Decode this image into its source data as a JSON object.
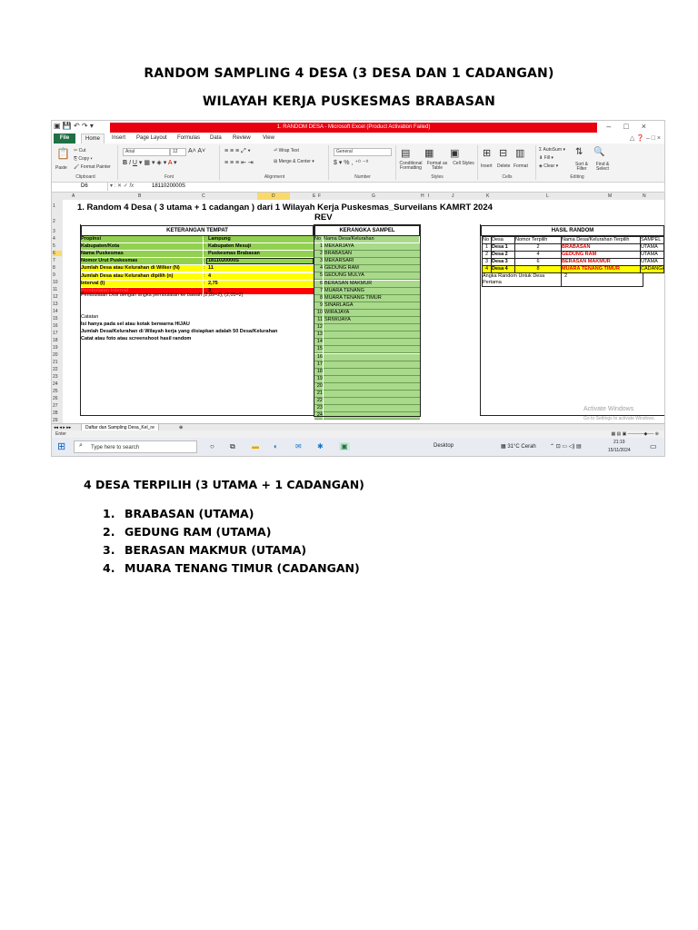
{
  "doc": {
    "title1": "RANDOM SAMPLING 4 DESA (3 DESA DAN 1 CADANGAN)",
    "title2": "WILAYAH KERJA PUSKESMAS BRABASAN",
    "subheading": "4 DESA TERPILIH (3 UTAMA + 1 CADANGAN)",
    "selected": [
      {
        "num": "1.",
        "text": "BRABASAN (UTAMA)"
      },
      {
        "num": "2.",
        "text": "GEDUNG RAM (UTAMA)"
      },
      {
        "num": "3.",
        "text": "BERASAN MAKMUR (UTAMA)"
      },
      {
        "num": "4.",
        "text": "MUARA TENANG TIMUR (CADANGAN)"
      }
    ]
  },
  "excel": {
    "window_title": "1. RANDOM DESA - Microsoft Excel (Product Activation Failed)",
    "menu": {
      "file": "File",
      "tabs": [
        "Home",
        "Insert",
        "Page Layout",
        "Formulas",
        "Data",
        "Review",
        "View"
      ]
    },
    "ribbon": {
      "cut": "Cut",
      "copy": "Copy",
      "paste": "Paste",
      "format_painter": "Format Painter",
      "clipboard": "Clipboard",
      "font_name": "Arial",
      "font_size": "12",
      "font_group": "Font",
      "wrap_text": "Wrap Text",
      "merge_center": "Merge & Center",
      "alignment": "Alignment",
      "number_format": "General",
      "number": "Number",
      "conditional": "Conditional Formatting",
      "format_table": "Format as Table",
      "cell_styles": "Cell Styles",
      "styles": "Styles",
      "insert": "Insert",
      "delete": "Delete",
      "format": "Format",
      "cells": "Cells",
      "autosum": "AutoSum",
      "fill": "Fill",
      "clear": "Clear",
      "sort_filter": "Sort & Filter",
      "find_select": "Find & Select",
      "editing": "Editing"
    },
    "name_box": "D6",
    "formula_value": "1811020000S",
    "columns": [
      "A",
      "B",
      "C",
      "D",
      "E",
      "F",
      "G",
      "H",
      "I",
      "J",
      "K",
      "L",
      "M",
      "N"
    ],
    "sheet_title_1": "1. Random 4 Desa ( 3 utama + 1 cadangan ) dari 1 Wilayah Kerja Puskesmas_Surveilans KAMRT 2024",
    "sheet_title_2": "REV",
    "keterangan_header": "KETERANGAN  TEMPAT",
    "keterangan": [
      {
        "label": "Propinsi",
        "sep": ":",
        "value": "Lampung"
      },
      {
        "label": "Kabupaten/Kota",
        "sep": ":",
        "value": "Kabupaten Mesuji"
      },
      {
        "label": "Nama Puskesmas",
        "sep": ":",
        "value": "Puskesmas Brabasan"
      },
      {
        "label": "Nomor Urut Puskesmas",
        "sep": ":",
        "value": "1811020000S"
      },
      {
        "label": "Jumlah Desa atau Kelurahan di Wilker (N)",
        "sep": ":",
        "value": "11"
      },
      {
        "label": "Jumlah Desa atau Kelurahan dipilih (n)",
        "sep": ":",
        "value": "4"
      },
      {
        "label": "Interval (I)",
        "sep": ":",
        "value": "2,75"
      },
      {
        "label": "Pembulatan Interval",
        "sep": ":",
        "value": "3"
      }
    ],
    "pembulatan_note": "Pembulatan Disii dengan angka pembulatan ke bawah (2,89≈2), (2,05≈2)",
    "catatan": [
      "Catatan",
      "Isi hanya pada sel atau kotak berwarna HIJAU",
      "Jumlah Desa/Kelurahan di Wilayah kerja yang disiapkan adalah 50 Desa/Kelurahan",
      "Catat atau foto atau screenshoot hasil random"
    ],
    "kerangka_header": "KERANGKA SAMPEL",
    "kerangka_cols": [
      "No",
      "Nama Desa/Kelurahan"
    ],
    "kerangka": [
      "MEKARJAYA",
      "BRABASAN",
      "MEKARSARI",
      "GEDUNG RAM",
      "GEDUNG MULYA",
      "BERASAN MAKMUR",
      "MUARA TENANG",
      "MUARA TENANG TIMUR",
      "SINARLAGA",
      "WIRAJAYA",
      "SRIWIJAYA",
      "",
      "",
      "",
      "",
      "",
      "",
      "",
      "",
      "",
      "",
      "",
      "",
      ""
    ],
    "hasil_header": "HASIL RANDOM",
    "hasil_cols": [
      "No",
      "Desa",
      "Nomor Terpilih",
      "Nama Desa/Kelurahan Terpilih",
      "SAMPEL"
    ],
    "hasil": [
      {
        "no": "1",
        "desa": "Desa 1",
        "nomor": "2",
        "nama": "BRABASAN",
        "sampel": "UTAMA"
      },
      {
        "no": "2",
        "desa": "Desa 2",
        "nomor": "4",
        "nama": "GEDUNG RAM",
        "sampel": "UTAMA"
      },
      {
        "no": "3",
        "desa": "Desa 3",
        "nomor": "6",
        "nama": "BERASAN MAKMUR",
        "sampel": "UTAMA"
      },
      {
        "no": "4",
        "desa": "Desa 4",
        "nomor": "8",
        "nama": "MUARA TENANG TIMUR",
        "sampel": "CADANGAN"
      }
    ],
    "angka_label": "Angka Random Untuk Desa Pertama",
    "angka_value": "2",
    "sheet_tab": "Daftar dan Sampling Desa_Kel_re",
    "status": "Enter",
    "activate_1": "Activate Windows",
    "activate_2": "Go to Settings to activate Windows."
  },
  "taskbar": {
    "search_placeholder": "Type here to search",
    "desktop": "Desktop",
    "weather": "31°C  Cerah",
    "time": "21:19",
    "date": "15/11/2024"
  }
}
